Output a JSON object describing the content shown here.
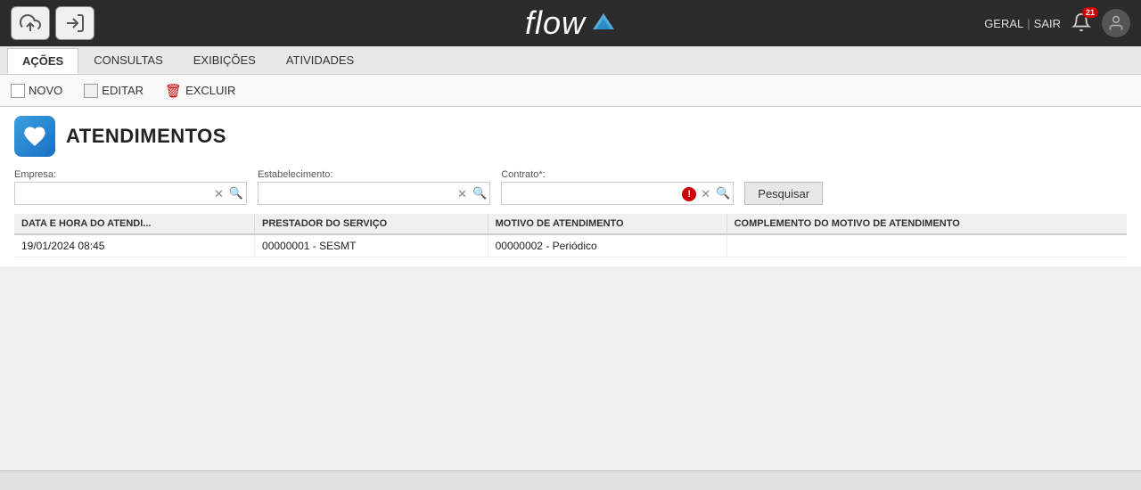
{
  "app": {
    "title": "flow",
    "logo_text": "flow"
  },
  "topbar": {
    "links": {
      "geral": "GERAL",
      "separator": "|",
      "sair": "SAIR"
    },
    "notification_count": "21",
    "btn_upload_tooltip": "Upload",
    "btn_exit_tooltip": "Sair"
  },
  "toolbar": {
    "tabs": [
      {
        "id": "acoes",
        "label": "AÇÕES",
        "active": true
      },
      {
        "id": "consultas",
        "label": "CONSULTAS",
        "active": false
      },
      {
        "id": "exibicoes",
        "label": "EXIBIÇÕES",
        "active": false
      },
      {
        "id": "atividades",
        "label": "ATIVIDADES",
        "active": false
      }
    ]
  },
  "actions": {
    "novo_label": "NOVO",
    "editar_label": "EDITAR",
    "excluir_label": "EXCLUIR"
  },
  "page": {
    "title": "ATENDIMENTOS",
    "icon_alt": "heartbeat-icon"
  },
  "filters": {
    "empresa_label": "Empresa:",
    "empresa_value": "",
    "empresa_placeholder": "",
    "estabelecimento_label": "Estabelecimento:",
    "estabelecimento_value": "",
    "estabelecimento_placeholder": "",
    "contrato_label": "Contrato*:",
    "contrato_value": "",
    "contrato_placeholder": "",
    "pesquisar_label": "Pesquisar"
  },
  "table": {
    "columns": [
      "DATA E HORA DO ATENDI...",
      "PRESTADOR DO SERVIÇO",
      "MOTIVO DE ATENDIMENTO",
      "COMPLEMENTO DO MOTIVO DE ATENDIMENTO"
    ],
    "rows": [
      {
        "data_hora": "19/01/2024 08:45",
        "prestador": "00000001 - SESMT",
        "motivo": "00000002 - Periódico",
        "complemento": ""
      }
    ]
  },
  "statusbar": {
    "text": ""
  }
}
